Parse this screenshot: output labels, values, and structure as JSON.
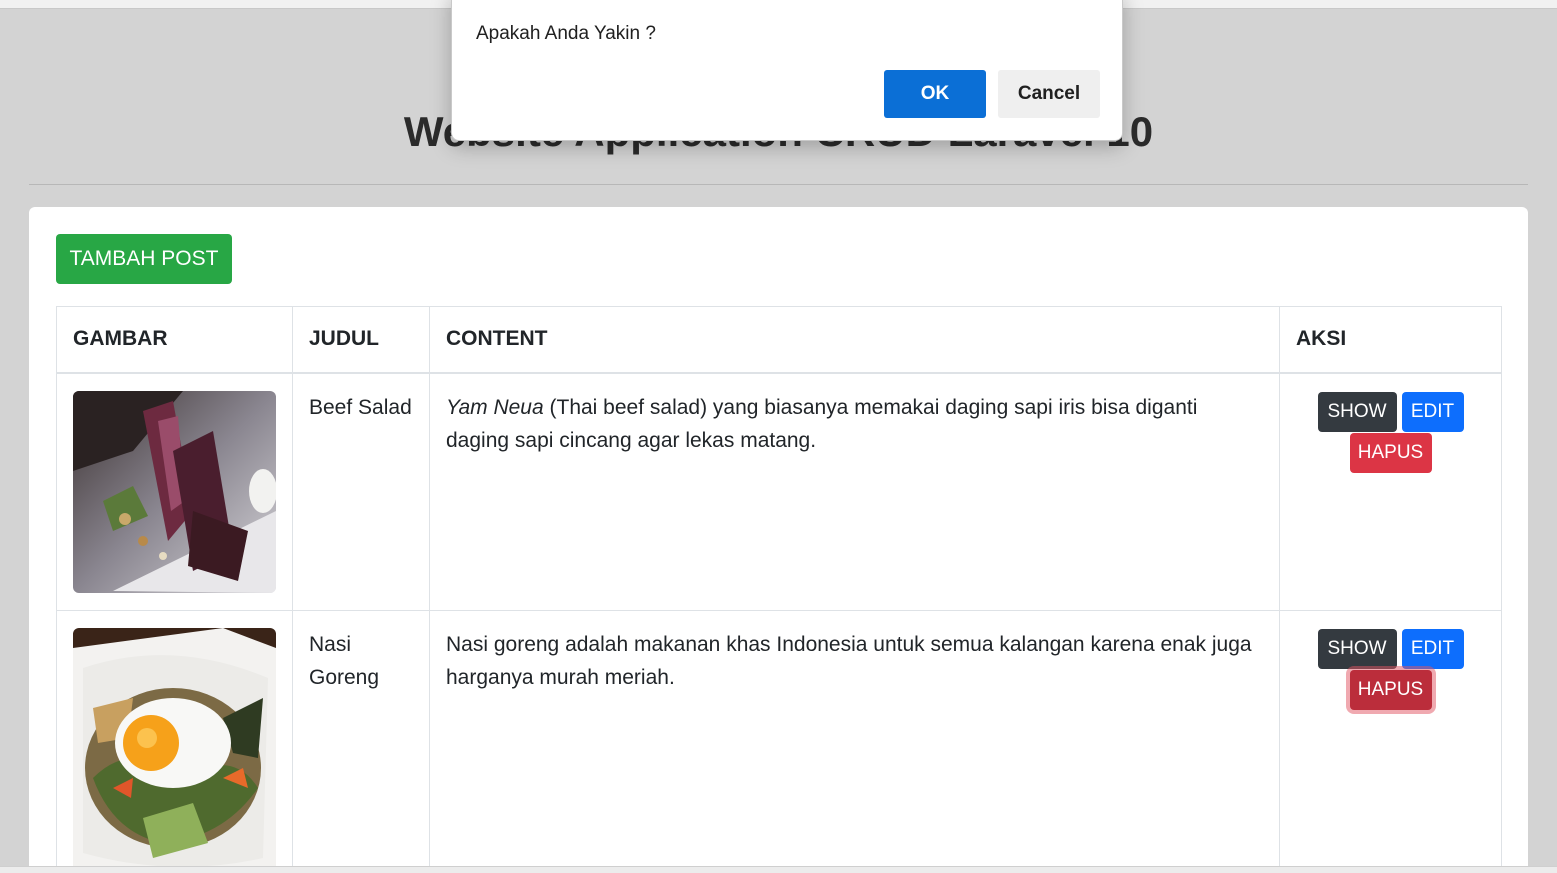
{
  "page": {
    "title": "Website Application CRUD Laravel 10"
  },
  "toolbar": {
    "add_label": "TAMBAH POST"
  },
  "table": {
    "headers": [
      "GAMBAR",
      "JUDUL",
      "CONTENT",
      "AKSI"
    ],
    "rows": [
      {
        "image": "beef-salad-photo",
        "judul": "Beef Salad",
        "content_italic": "Yam Neua",
        "content": " (Thai beef salad) yang biasanya memakai daging sapi iris bisa diganti daging sapi cincang agar lekas matang.",
        "show_label": "SHOW",
        "edit_label": "EDIT",
        "hapus_label": "HAPUS"
      },
      {
        "image": "nasi-goreng-photo",
        "judul": "Nasi Goreng",
        "content": "Nasi goreng adalah makanan khas Indonesia untuk semua kalangan karena enak juga harganya murah meriah.",
        "show_label": "SHOW",
        "edit_label": "EDIT",
        "hapus_label": "HAPUS"
      }
    ]
  },
  "dialog": {
    "message": "Apakah Anda Yakin ?",
    "ok_label": "OK",
    "cancel_label": "Cancel"
  },
  "colors": {
    "success": "#28a745",
    "dark": "#343a40",
    "primary": "#0d6efd",
    "danger": "#dc3545",
    "dialog_ok": "#0b6fd6"
  }
}
